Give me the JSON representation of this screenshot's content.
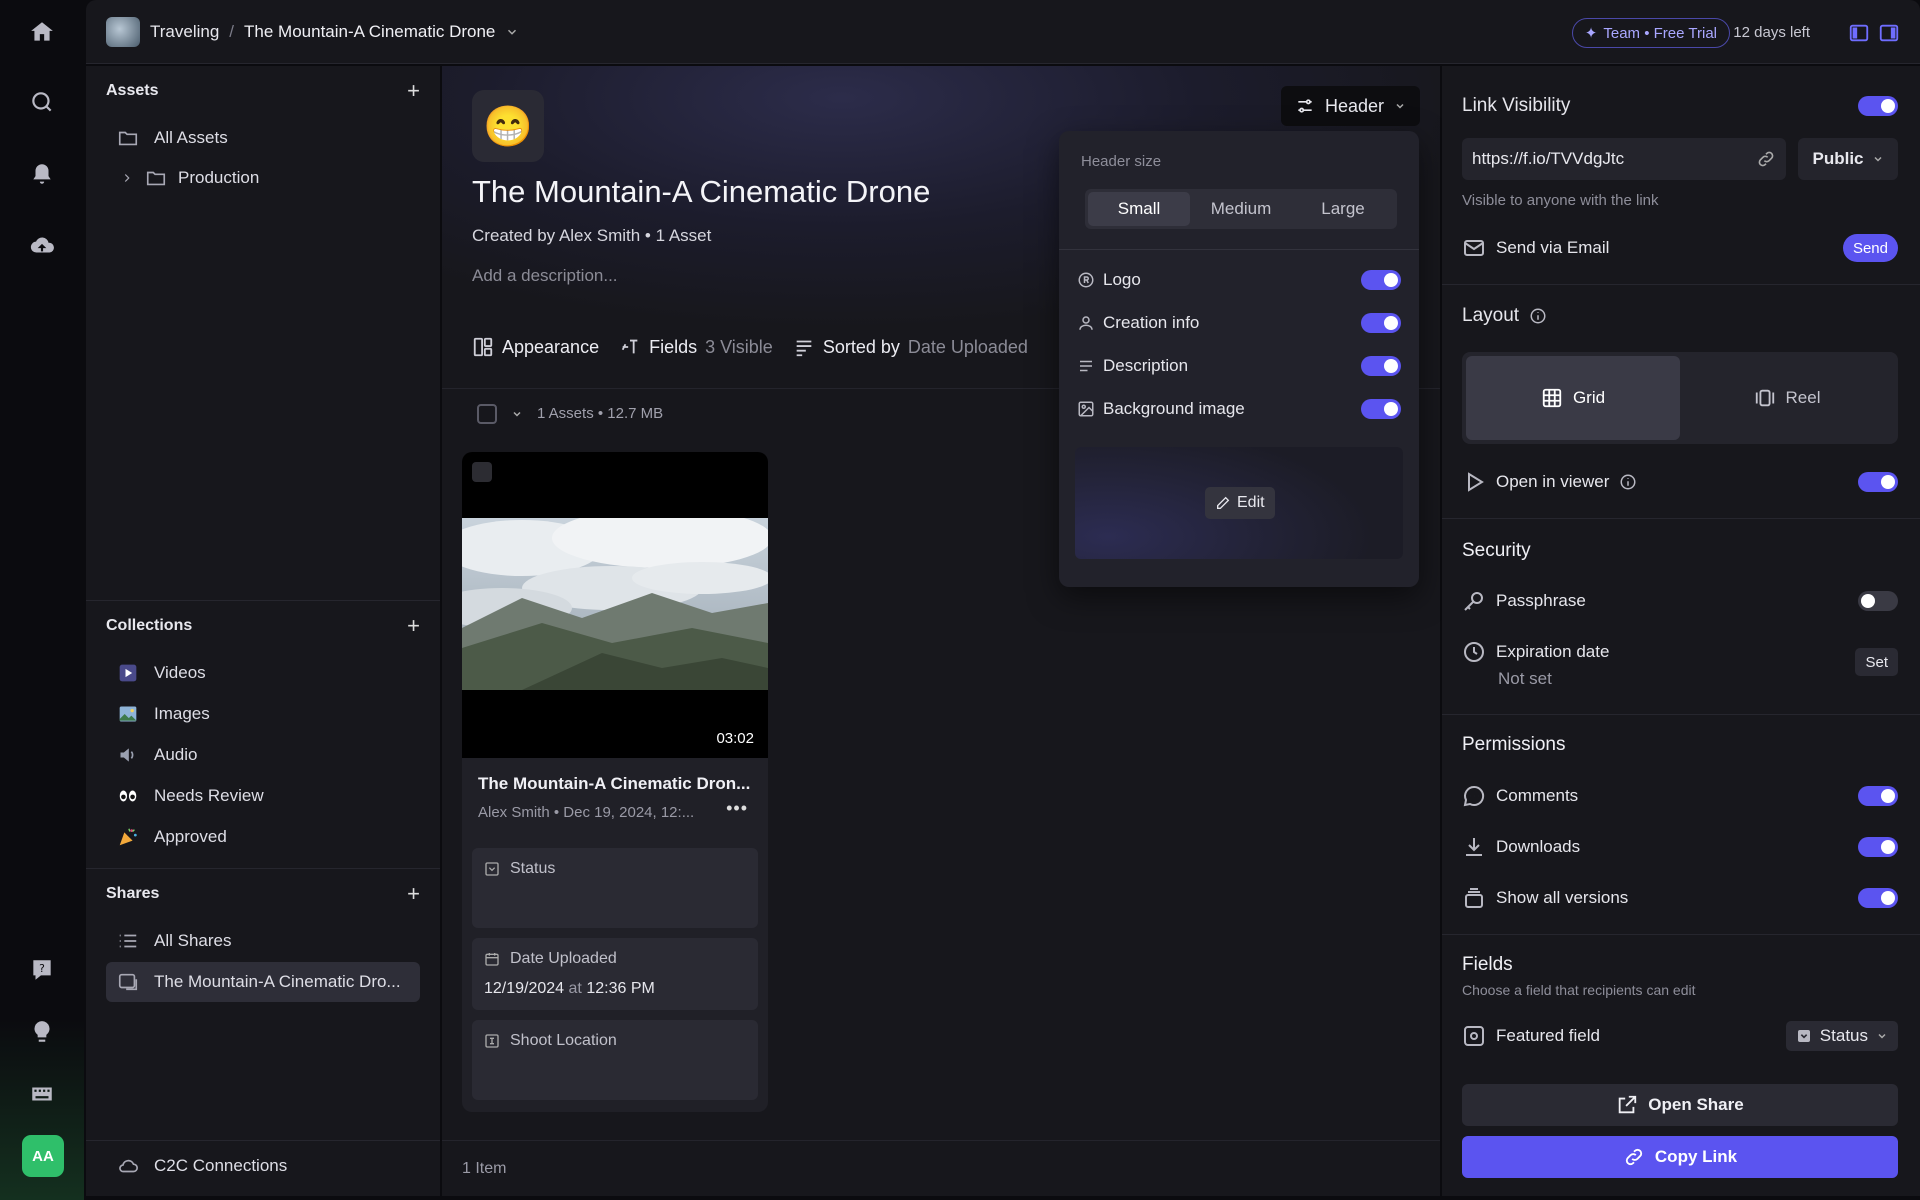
{
  "topbar": {
    "breadcrumb_parent": "Traveling",
    "breadcrumb_sep": "/",
    "breadcrumb_current": "The Mountain-A Cinematic Drone",
    "trial_badge": "Team • Free Trial",
    "days_left": "12 days left"
  },
  "rail": {
    "avatar_initials": "AA",
    "accent_color": "#2fbf6a"
  },
  "sidebar": {
    "assets_heading": "Assets",
    "assets_items": [
      {
        "label": "All Assets",
        "icon": "folder-icon"
      },
      {
        "label": "Production",
        "icon": "folder-icon"
      }
    ],
    "collections_heading": "Collections",
    "collections_items": [
      {
        "label": "Videos",
        "icon": "video-icon"
      },
      {
        "label": "Images",
        "icon": "image-icon"
      },
      {
        "label": "Audio",
        "icon": "speaker-icon"
      },
      {
        "label": "Needs Review",
        "icon": "eyes-icon"
      },
      {
        "label": "Approved",
        "icon": "party-icon"
      }
    ],
    "shares_heading": "Shares",
    "shares_items": [
      {
        "label": "All Shares",
        "icon": "list-icon"
      },
      {
        "label": "The Mountain-A Cinematic Dro...",
        "icon": "share-icon"
      }
    ],
    "footer_item": "C2C Connections"
  },
  "main": {
    "emoji": "😁",
    "title": "The Mountain-A Cinematic Drone",
    "created": "Created by Alex Smith • 1 Asset",
    "description_placeholder": "Add a description...",
    "header_button": "Header",
    "toolbar": {
      "appearance": "Appearance",
      "fields": "Fields",
      "fields_count": "3 Visible",
      "sorted_by": "Sorted by",
      "sorted_value": "Date Uploaded"
    },
    "list_summary": "1 Assets • 12.7 MB",
    "card": {
      "duration": "03:02",
      "title": "The Mountain-A Cinematic Dron...",
      "meta": "Alex Smith • Dec 19, 2024, 12:...",
      "more": "•••",
      "fields": [
        {
          "label": "Status",
          "value": ""
        },
        {
          "label": "Date Uploaded",
          "value_date": "12/19/2024",
          "value_at": "at",
          "value_time": "12:36 PM"
        },
        {
          "label": "Shoot Location",
          "value": ""
        }
      ]
    },
    "footer": "1 Item"
  },
  "popover": {
    "size_label": "Header size",
    "sizes": [
      "Small",
      "Medium",
      "Large"
    ],
    "selected_size": "Small",
    "rows": [
      {
        "label": "Logo",
        "on": true
      },
      {
        "label": "Creation info",
        "on": true
      },
      {
        "label": "Description",
        "on": true
      },
      {
        "label": "Background image",
        "on": true
      }
    ],
    "edit_label": "Edit"
  },
  "right": {
    "link_visibility": "Link Visibility",
    "link_visibility_on": true,
    "url": "https://f.io/TVVdgJtc",
    "access": "Public",
    "visibility_note": "Visible to anyone with the link",
    "send_email": "Send via Email",
    "send_button": "Send",
    "layout_heading": "Layout",
    "layout_options": [
      "Grid",
      "Reel"
    ],
    "layout_selected": "Grid",
    "open_in_viewer": "Open in viewer",
    "security_heading": "Security",
    "passphrase": "Passphrase",
    "expiration": "Expiration date",
    "expiration_value": "Not set",
    "set_button": "Set",
    "permissions_heading": "Permissions",
    "comments": "Comments",
    "downloads": "Downloads",
    "show_versions": "Show all versions",
    "fields_heading": "Fields",
    "fields_note": "Choose a field that recipients can edit",
    "featured_field": "Featured field",
    "featured_value": "Status",
    "open_share": "Open Share",
    "copy_link": "Copy Link",
    "accent_color": "#5b54f0"
  }
}
